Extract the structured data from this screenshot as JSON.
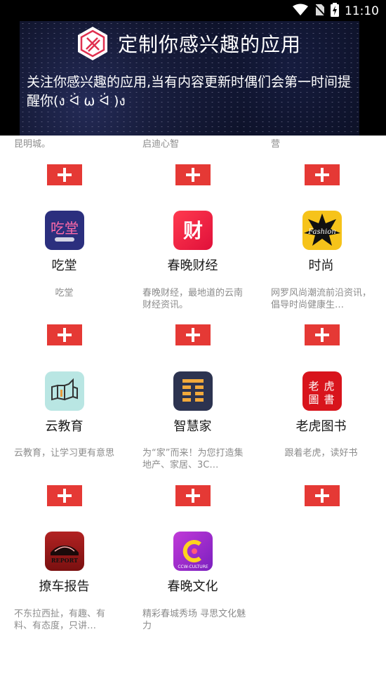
{
  "status_bar": {
    "time": "11:10"
  },
  "header": {
    "title": "定制你感兴趣的应用",
    "description": "关注你感兴趣的应用,当有内容更新时偶们会第一时间提醒你(ง ᐛ ω ᐛ )ง"
  },
  "partial_row": {
    "descriptions": [
      "昆明城。",
      "启迪心智",
      "营"
    ]
  },
  "apps": [
    {
      "name": "吃堂",
      "description": "吃堂",
      "icon": "chitang-logo-icon",
      "color": "#2b2f7e"
    },
    {
      "name": "春晚财经",
      "description": "春晚财经，最地道的云南财经资讯。",
      "icon": "cai-logo-icon",
      "color": "#f0203f"
    },
    {
      "name": "时尚",
      "description": "网罗风尚潮流前沿资讯，倡导时尚健康生…",
      "icon": "fashion-logo-icon",
      "color": "#f6c31a"
    },
    {
      "name": "云教育",
      "description": "云教育，让学习更有意思",
      "icon": "book-logo-icon",
      "color": "#b9e6e3"
    },
    {
      "name": "智慧家",
      "description": "为“家”而来！为您打造集地产、家居、3C…",
      "icon": "zhihuijia-logo-icon",
      "color": "#2c3350"
    },
    {
      "name": "老虎图书",
      "description": "跟着老虎，读好书",
      "icon": "laohu-logo-icon",
      "color": "#d8141c"
    },
    {
      "name": "撩车报告",
      "description": "不东拉西扯，有趣、有料、有态度，只讲…",
      "icon": "car-logo-icon",
      "color": "#9b1a1a"
    },
    {
      "name": "春晚文化",
      "description": "精彩春城秀场  寻思文化魅力",
      "icon": "culture-logo-icon",
      "color": "#9a2fd1"
    }
  ]
}
